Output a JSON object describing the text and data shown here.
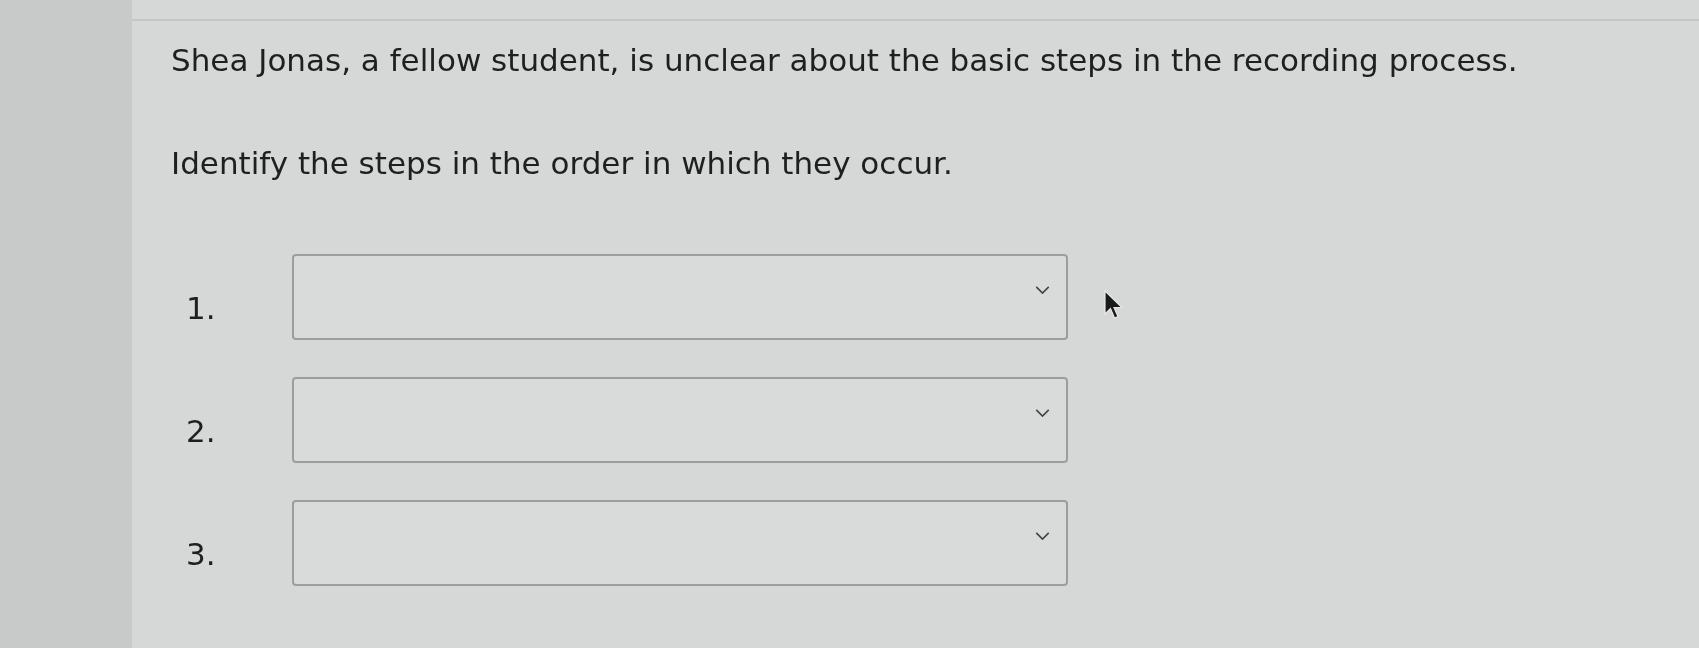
{
  "question": {
    "prompt": "Shea Jonas, a fellow student, is unclear about the basic steps in the recording process.",
    "instruction": "Identify the steps in the order in which they occur."
  },
  "steps": [
    {
      "number": "1."
    },
    {
      "number": "2."
    },
    {
      "number": "3."
    }
  ]
}
